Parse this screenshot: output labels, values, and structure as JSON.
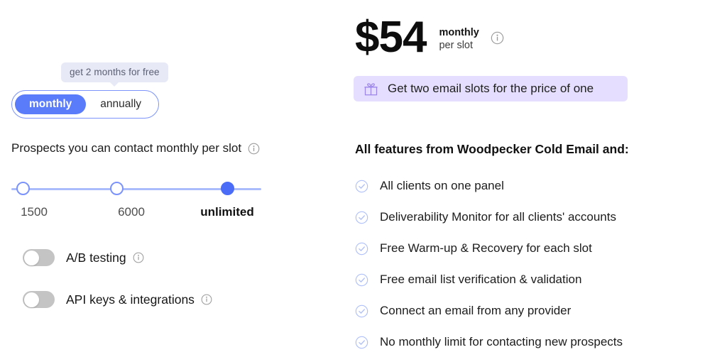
{
  "billing": {
    "promo_tooltip": "get 2 months for free",
    "options": [
      {
        "label": "monthly",
        "active": true
      },
      {
        "label": "annually",
        "active": false
      }
    ]
  },
  "price": {
    "amount": "$54",
    "period": "monthly",
    "unit": "per slot",
    "info_icon": "info-icon"
  },
  "promo_banner": {
    "icon": "gift-icon",
    "text": "Get two email slots for the price of one",
    "background": "#e6deff",
    "icon_color": "#9b86e8"
  },
  "slider": {
    "title": "Prospects you can contact monthly per slot",
    "title_info_icon": "info-icon",
    "stops": [
      {
        "label": "1500",
        "selected": false,
        "pos": 0
      },
      {
        "label": "6000",
        "selected": false,
        "pos": 41.5
      },
      {
        "label": "unlimited",
        "selected": true,
        "pos": 90
      }
    ],
    "track_color": "#aabcfb",
    "selected_color": "#4a6cf7"
  },
  "feature_toggles": [
    {
      "label": "A/B testing",
      "enabled": false,
      "info_icon": "info-icon"
    },
    {
      "label": "API keys & integrations",
      "enabled": false,
      "info_icon": "info-icon"
    }
  ],
  "features": {
    "heading": "All features from Woodpecker Cold Email and:",
    "items": [
      "All clients on one panel",
      "Deliverability Monitor for all clients' accounts",
      "Free Warm-up & Recovery for each slot",
      "Free email list verification & validation",
      "Connect an email from any provider",
      "No monthly limit for contacting new prospects"
    ],
    "check_icon": "check-circle-icon",
    "check_color": "#aebffa"
  },
  "colors": {
    "accent_blue": "#5b7cfa",
    "accent_blue_dark": "#4a6cf7",
    "promo_purple": "#e6deff",
    "tooltip_bg": "#e7e9f7",
    "toggle_off": "#c4c4c4"
  }
}
